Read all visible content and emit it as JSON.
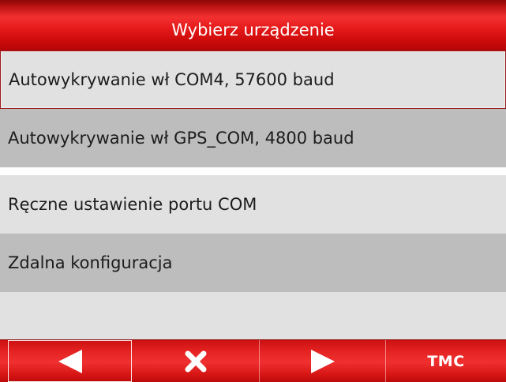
{
  "header": {
    "title": "Wybierz urządzenie"
  },
  "devices": {
    "items": [
      {
        "label": "Autowykrywanie wł COM4, 57600 baud",
        "selected": true
      },
      {
        "label": "Autowykrywanie wł GPS_COM, 4800 baud",
        "selected": false
      },
      {
        "label": "Ręczne ustawienie portu COM",
        "selected": false
      },
      {
        "label": "Zdalna konfiguracja",
        "selected": false
      }
    ]
  },
  "toolbar": {
    "back_icon": "left-arrow-icon",
    "cancel_icon": "close-icon",
    "next_icon": "right-arrow-icon",
    "tmc_label": "TMC"
  },
  "colors": {
    "header_red": "#e61a1a",
    "list_light": "#e1e1e1",
    "list_dark": "#bdbdbd",
    "selection_border": "#9a1a1a",
    "text": "#1c1c1c",
    "toolbar_red": "#e42222"
  }
}
